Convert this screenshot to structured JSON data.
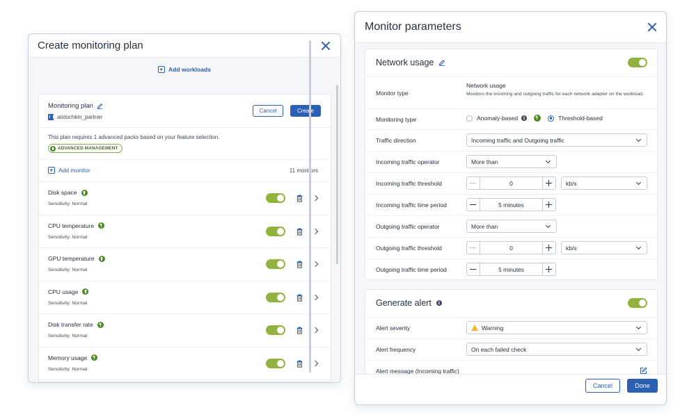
{
  "colors": {
    "accent": "#2b5fb3",
    "toggle_on": "#8fb33d",
    "upgrade_green": "#4a8a23",
    "warning": "#f2b631"
  },
  "left_dialog": {
    "title": "Create monitoring plan",
    "add_workloads": "Add workloads",
    "plan": {
      "name": "Monitoring plan",
      "owner": "aistochkin_partner",
      "cancel_label": "Cancel",
      "create_label": "Create",
      "note": "This plan requires 1 advanced packs based on your feature selection.",
      "badge": "ADVANCED MANAGEMENT"
    },
    "add_monitor": "Add monitor",
    "monitor_count": "11 monitors",
    "monitors": [
      {
        "name": "Disk space",
        "sensitivity": "Sensitivity: Normal",
        "enabled": true
      },
      {
        "name": "CPU temperature",
        "sensitivity": "Sensitivity: Normal",
        "enabled": true
      },
      {
        "name": "GPU temperature",
        "sensitivity": "Sensitivity: Normal",
        "enabled": true
      },
      {
        "name": "CPU usage",
        "sensitivity": "Sensitivity: Normal",
        "enabled": true
      },
      {
        "name": "Disk transfer rate",
        "sensitivity": "Sensitivity: Normal",
        "enabled": true
      },
      {
        "name": "Memory usage",
        "sensitivity": "Sensitivity: Normal",
        "enabled": true
      }
    ]
  },
  "right_dialog": {
    "title": "Monitor parameters",
    "network": {
      "title": "Network usage",
      "enabled": true,
      "monitor_type_label": "Monitor type",
      "monitor_type_value": "Network usage",
      "monitor_type_desc": "Monitors the incoming and outgoing traffic for each network adapter on the workload.",
      "monitoring_type_label": "Monitoring type",
      "option_anomaly": "Anomaly-based",
      "option_threshold": "Threshold-based",
      "selected_option": "Threshold-based",
      "traffic_direction_label": "Traffic direction",
      "traffic_direction_value": "Incoming traffic and Outgoing traffic",
      "in_operator_label": "Incoming traffic operator",
      "in_operator_value": "More than",
      "in_threshold_label": "Incoming traffic threshold",
      "in_threshold_value": "0",
      "in_threshold_unit": "kb/s",
      "in_period_label": "Incoming traffic time period",
      "in_period_value": "5 minutes",
      "out_operator_label": "Outgoing traffic operator",
      "out_operator_value": "More than",
      "out_threshold_label": "Outgoing traffic threshold",
      "out_threshold_value": "0",
      "out_threshold_unit": "kb/s",
      "out_period_label": "Outgoing traffic time period",
      "out_period_value": "5 minutes"
    },
    "alert": {
      "title": "Generate alert",
      "enabled": true,
      "severity_label": "Alert severity",
      "severity_value": "Warning",
      "frequency_label": "Alert frequency",
      "frequency_value": "On each failed check",
      "message_label": "Alert message (Incoming traffic)"
    },
    "cancel_label": "Cancel",
    "done_label": "Done"
  }
}
